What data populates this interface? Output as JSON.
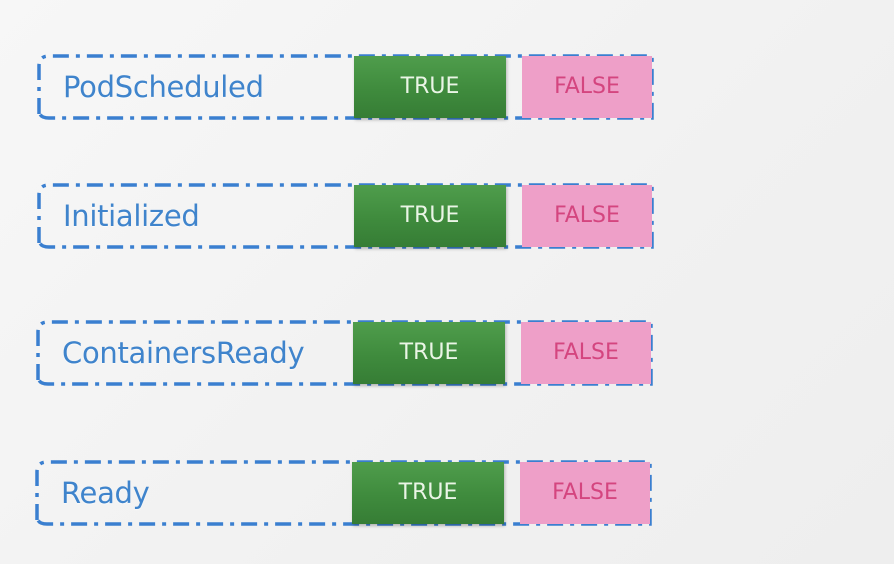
{
  "conditions": [
    {
      "label": "PodScheduled",
      "true_label": "TRUE",
      "false_label": "FALSE"
    },
    {
      "label": "Initialized",
      "true_label": "TRUE",
      "false_label": "FALSE"
    },
    {
      "label": "ContainersReady",
      "true_label": "TRUE",
      "false_label": "FALSE"
    },
    {
      "label": "Ready",
      "true_label": "TRUE",
      "false_label": "FALSE"
    }
  ],
  "colors": {
    "label_text": "#3f84cc",
    "dash_border": "#3a7fd0",
    "true_fill": "#3f8b3d",
    "true_text": "#eaf5e6",
    "false_fill": "#ee9fc8",
    "false_text": "#d4457f"
  }
}
